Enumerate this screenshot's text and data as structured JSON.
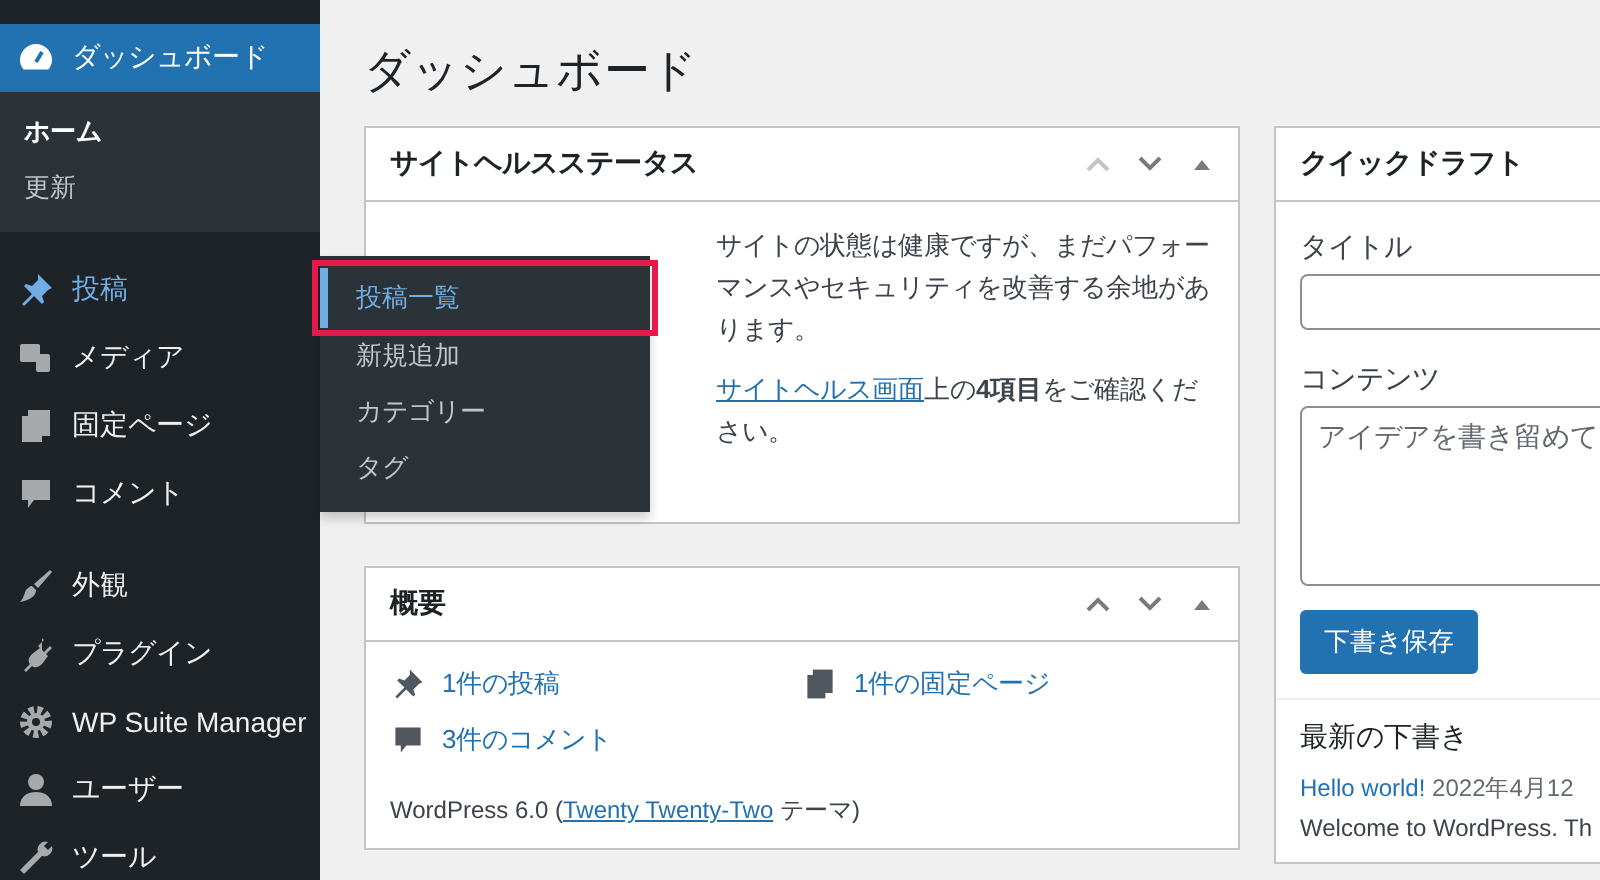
{
  "sidebar": {
    "items": [
      {
        "label": "ダッシュボード",
        "selected": true,
        "open": false,
        "children": [
          {
            "label": "ホーム",
            "selected": true
          },
          {
            "label": "更新",
            "selected": false
          }
        ]
      },
      {
        "label": "投稿",
        "selected": false,
        "open": true
      },
      {
        "label": "メディア",
        "selected": false,
        "open": false
      },
      {
        "label": "固定ページ",
        "selected": false,
        "open": false
      },
      {
        "label": "コメント",
        "selected": false,
        "open": false
      },
      {
        "label": "外観",
        "selected": false,
        "open": false
      },
      {
        "label": "プラグイン",
        "selected": false,
        "open": false
      },
      {
        "label": "WP Suite Manager",
        "selected": false,
        "open": false
      },
      {
        "label": "ユーザー",
        "selected": false,
        "open": false
      },
      {
        "label": "ツール",
        "selected": false,
        "open": false
      }
    ]
  },
  "flyout": {
    "items": [
      {
        "label": "投稿一覧",
        "selected": true,
        "highlighted": true
      },
      {
        "label": "新規追加",
        "selected": false,
        "highlighted": false
      },
      {
        "label": "カテゴリー",
        "selected": false,
        "highlighted": false
      },
      {
        "label": "タグ",
        "selected": false,
        "highlighted": false
      }
    ]
  },
  "page_title": "ダッシュボード",
  "site_health": {
    "title": "サイトヘルスステータス",
    "status": "サイトの状態は健康ですが、まだパフォーマンスやセキュリティを改善する余地があります。",
    "link": "サイトヘルス画面",
    "after_link": "上の**4項目**をご確認ください。"
  },
  "overview": {
    "title": "概要",
    "stats": [
      {
        "label": "1件の投稿"
      },
      {
        "label": "1件の固定ページ"
      },
      {
        "label": "3件のコメント"
      }
    ],
    "version": "WordPress 6.0 (",
    "theme": "Twenty Twenty-Two",
    "theme_suffix": " テーマ)"
  },
  "quick_draft": {
    "title": "クイックドラフト",
    "title_label": "タイトル",
    "content_label": "コンテンツ",
    "content_placeholder": "アイデアを書き留めて",
    "save_button": "下書き保存",
    "recent_heading": "最新の下書き",
    "drafts": [
      {
        "title": "Hello world!",
        "date": "2022年4月12",
        "excerpt": "Welcome to WordPress. Th"
      }
    ]
  }
}
